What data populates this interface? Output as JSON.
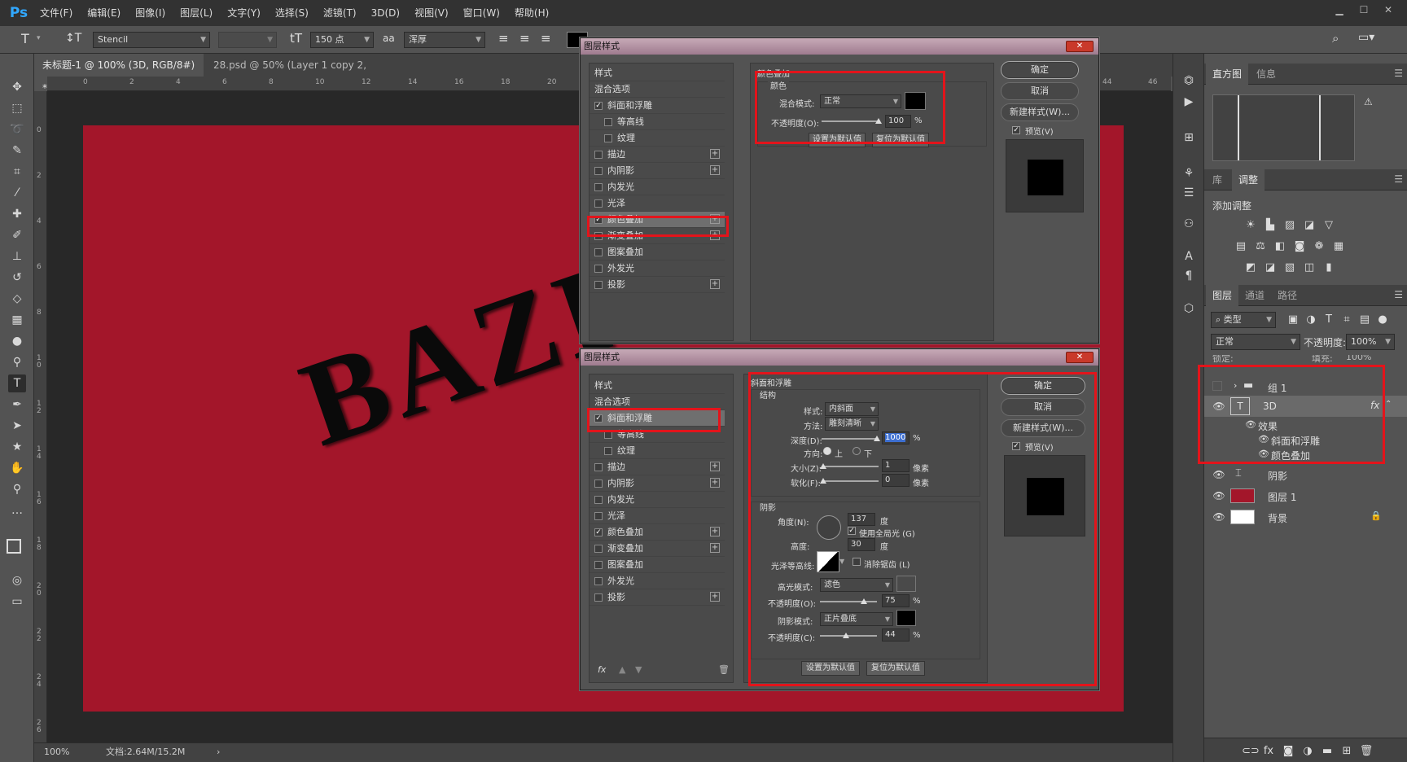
{
  "app": {
    "logo": "Ps"
  },
  "menu": [
    "文件(F)",
    "编辑(E)",
    "图像(I)",
    "图层(L)",
    "文字(Y)",
    "选择(S)",
    "滤镜(T)",
    "3D(D)",
    "视图(V)",
    "窗口(W)",
    "帮助(H)"
  ],
  "options": {
    "font_family": "Stencil",
    "font_size": "150 点",
    "anti_alias_icon": "aa",
    "anti_alias": "浑厚"
  },
  "tabs": [
    {
      "label": "未标题-1 @ 100% (3D, RGB/8#) *"
    },
    {
      "label": "28.psd @ 50% (Layer 1 copy 2, RGB/8) *"
    }
  ],
  "ruler_h": [
    "0",
    "2",
    "4",
    "6",
    "8",
    "10",
    "12",
    "14",
    "16",
    "18",
    "20",
    "44",
    "46"
  ],
  "ruler_v": [
    "0",
    "2",
    "4",
    "6",
    "8",
    "10",
    "12",
    "14",
    "16",
    "18",
    "20",
    "22",
    "24",
    "26"
  ],
  "canvas": {
    "text": "BAZI"
  },
  "status": {
    "zoom": "100%",
    "doc": "文档:2.64M/15.2M"
  },
  "panels": {
    "histogram_tabs": [
      "直方图",
      "信息"
    ],
    "adjust_tabs": [
      "库",
      "调整"
    ],
    "adjust_title": "添加调整",
    "layers_tabs": [
      "图层",
      "通道",
      "路径"
    ],
    "filter_kind": "类型",
    "blend_mode": "正常",
    "opacity_label": "不透明度:",
    "opacity_value": "100%",
    "lock_label": "锁定:",
    "fill_label": "填充:",
    "fill_value": "100%",
    "layers": [
      {
        "name": "组 1"
      },
      {
        "name": "3D",
        "fx": "fx"
      },
      {
        "name": "效果"
      },
      {
        "name": "斜面和浮雕"
      },
      {
        "name": "颜色叠加"
      },
      {
        "name": "阴影"
      },
      {
        "name": "图层 1"
      },
      {
        "name": "背景"
      }
    ]
  },
  "style_list": [
    "样式",
    "混合选项",
    "斜面和浮雕",
    "等高线",
    "纹理",
    "描边",
    "内阴影",
    "内发光",
    "光泽",
    "颜色叠加",
    "渐变叠加",
    "图案叠加",
    "外发光",
    "投影"
  ],
  "dialog1": {
    "title": "图层样式",
    "close": "✕",
    "section": "颜色叠加",
    "group": "颜色",
    "blend_label": "混合模式:",
    "blend_value": "正常",
    "opacity_label": "不透明度(O):",
    "opacity_value": "100",
    "unit": "%",
    "btn_default": "设置为默认值",
    "btn_reset": "复位为默认值",
    "ok": "确定",
    "cancel": "取消",
    "new_style": "新建样式(W)...",
    "preview": "预览(V)"
  },
  "dialog2": {
    "title": "图层样式",
    "close": "✕",
    "section": "斜面和浮雕",
    "structure": "结构",
    "style_label": "样式:",
    "style_value": "内斜面",
    "technique_label": "方法:",
    "technique_value": "雕刻清晰",
    "depth_label": "深度(D):",
    "depth_value": "1000",
    "pct": "%",
    "direction_label": "方向:",
    "up": "上",
    "down": "下",
    "size_label": "大小(Z):",
    "size_value": "1",
    "soften_label": "软化(F):",
    "soften_value": "0",
    "px": "像素",
    "shading": "阴影",
    "angle_label": "角度(N):",
    "angle_value": "137",
    "deg": "度",
    "global_light": "使用全局光 (G)",
    "altitude_label": "高度:",
    "altitude_value": "30",
    "gloss_label": "光泽等高线:",
    "antialias": "消除锯齿 (L)",
    "highlight_label": "高光模式:",
    "highlight_value": "滤色",
    "hl_opacity_label": "不透明度(O):",
    "hl_opacity_value": "75",
    "shadow_label": "阴影模式:",
    "shadow_value": "正片叠底",
    "sh_opacity_label": "不透明度(C):",
    "sh_opacity_value": "44",
    "btn_default": "设置为默认值",
    "btn_reset": "复位为默认值",
    "ok": "确定",
    "cancel": "取消",
    "new_style": "新建样式(W)...",
    "preview": "预览(V)",
    "fx": "fx"
  }
}
